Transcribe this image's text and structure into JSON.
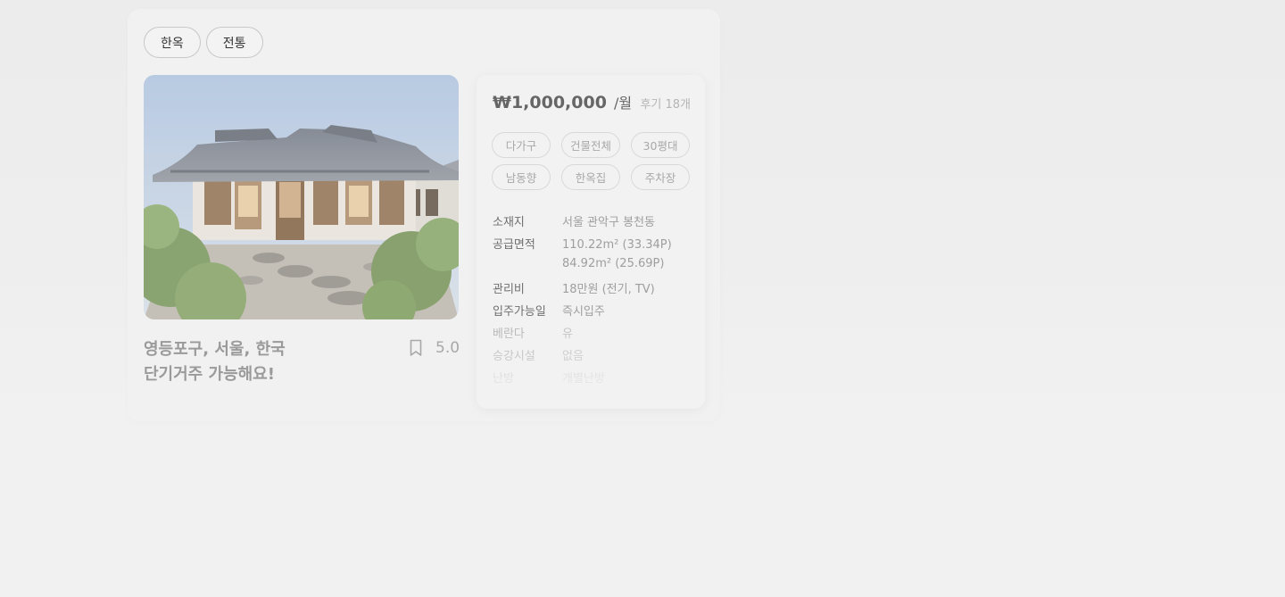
{
  "tags": [
    "한옥",
    "전통"
  ],
  "listing": {
    "title_line1": "영등포구, 서울, 한국",
    "title_line2": "단기거주 가능해요!",
    "rating": "5.0"
  },
  "info": {
    "price": "₩1,000,000",
    "price_unit": "/월",
    "reviews": "후기 18개",
    "chips": [
      "다가구",
      "건물전체",
      "30평대",
      "남동향",
      "한옥집",
      "주차장"
    ],
    "details": {
      "location": {
        "label": "소재지",
        "value": "서울 관악구 봉천동"
      },
      "supply_area": {
        "label": "공급면적",
        "value": "110.22m² (33.34P)",
        "value2": "84.92m² (25.69P)"
      },
      "maintenance_fee": {
        "label": "관리비",
        "value": "18만원 (전기, TV)"
      },
      "move_in_date": {
        "label": "입주가능일",
        "value": "즉시입주"
      },
      "balcony": {
        "label": "베란다",
        "value": "유"
      },
      "elevator": {
        "label": "승강시설",
        "value": "없음"
      },
      "heating": {
        "label": "난방",
        "value": "개별난방"
      }
    }
  },
  "colors": {
    "page_bg": "#f1f1f1",
    "sky": "#b9cbe0",
    "muted_text": "#9a9a9a"
  },
  "icons": {
    "bookmark": "bookmark-icon"
  }
}
